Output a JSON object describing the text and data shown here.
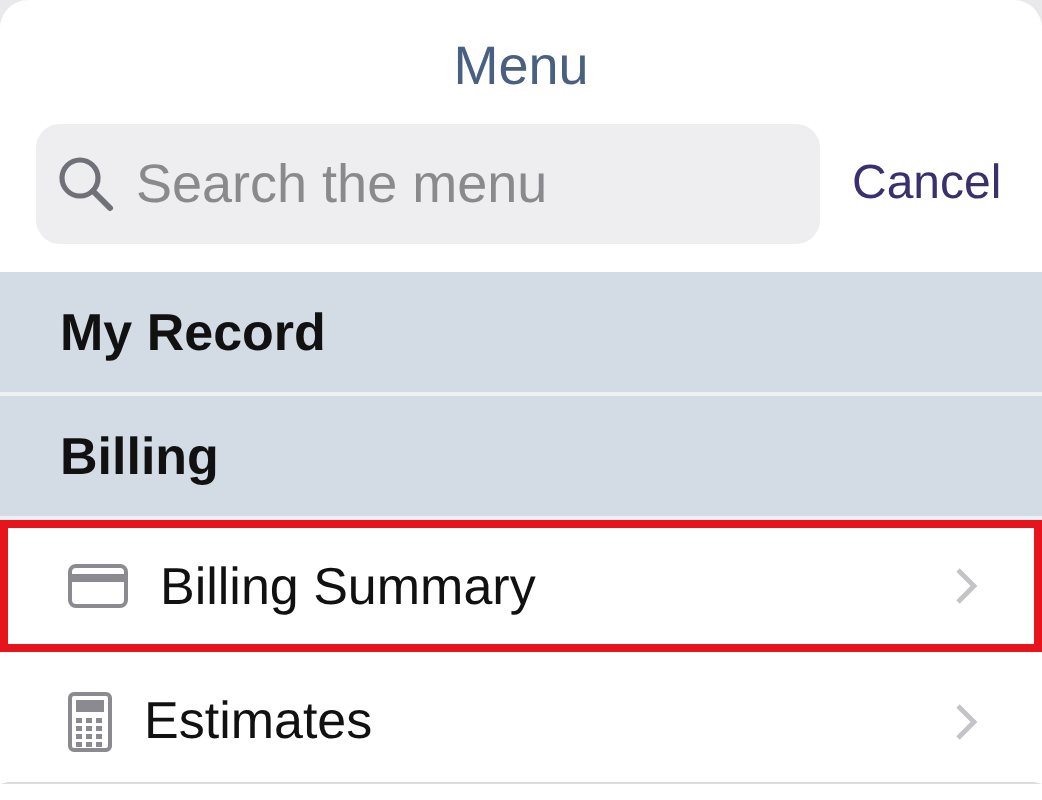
{
  "title": "Menu",
  "search": {
    "placeholder": "Search the menu"
  },
  "cancel": "Cancel",
  "items": [
    {
      "kind": "section",
      "label": "My Record"
    },
    {
      "kind": "section",
      "label": "Billing"
    },
    {
      "kind": "card",
      "label": "Billing Summary",
      "highlighted": true
    },
    {
      "kind": "calculator",
      "label": "Estimates",
      "highlighted": false
    }
  ]
}
